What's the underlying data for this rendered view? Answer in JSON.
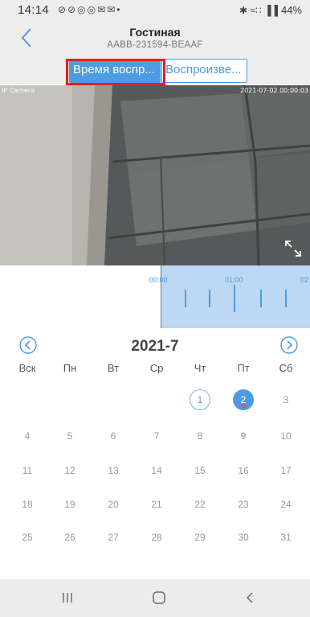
{
  "status_bar": {
    "time": "14:14",
    "left_icons": [
      "⊘",
      "⊘",
      "◎",
      "◎",
      "✉",
      "✉",
      "•"
    ],
    "right_icons": "✱ ≈∷ ▐▐",
    "battery": "44%"
  },
  "header": {
    "title": "Гостиная",
    "subtitle": "AABB-231594-BEAAF"
  },
  "tabs": {
    "active_label": "Время воспр...",
    "inactive_label": "Воспроизве..."
  },
  "video": {
    "camera_label": "IP Camera",
    "timestamp": "2021-07-02 00:00:03"
  },
  "timeline": {
    "labels": [
      "00:00",
      "01:00",
      "02"
    ]
  },
  "calendar": {
    "month_label": "2021-7",
    "weekdays": [
      "Вск",
      "Пн",
      "Вт",
      "Ср",
      "Чт",
      "Пт",
      "Сб"
    ],
    "days": [
      "1",
      "2",
      "3",
      "4",
      "5",
      "6",
      "7",
      "8",
      "9",
      "10",
      "11",
      "12",
      "13",
      "14",
      "15",
      "16",
      "17",
      "18",
      "19",
      "20",
      "21",
      "22",
      "23",
      "24",
      "25",
      "26",
      "27",
      "28",
      "29",
      "30",
      "31"
    ],
    "first_weekday_index": 4,
    "today": "1",
    "selected": "2"
  },
  "colors": {
    "accent": "#4d9be0",
    "highlight_box": "#e0211f",
    "timeline_fill": "#bcd8f2"
  }
}
